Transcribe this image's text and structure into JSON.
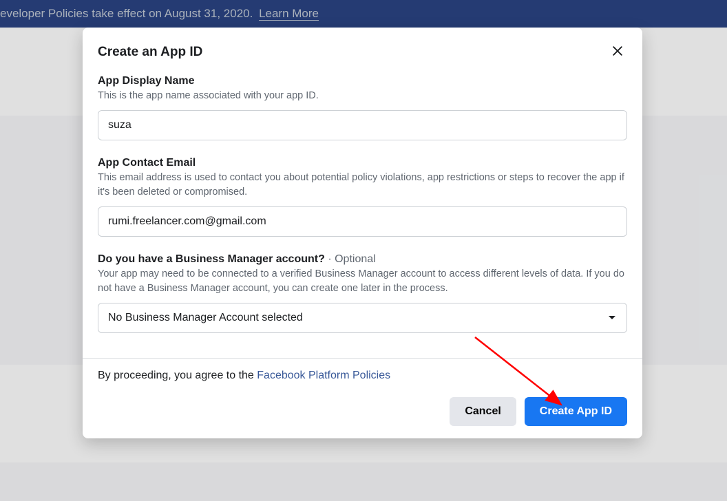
{
  "banner": {
    "text_prefix": "eveloper Policies take effect on August 31, 2020. ",
    "link": "Learn More"
  },
  "modal": {
    "title": "Create an App ID",
    "fields": {
      "display_name": {
        "label": "App Display Name",
        "help": "This is the app name associated with your app ID.",
        "value": "suza"
      },
      "contact_email": {
        "label": "App Contact Email",
        "help": "This email address is used to contact you about potential policy violations, app restrictions or steps to recover the app if it's been deleted or compromised.",
        "value": "rumi.freelancer.com@gmail.com"
      },
      "business_manager": {
        "label": "Do you have a Business Manager account?",
        "optional_tag": " · Optional",
        "help": "Your app may need to be connected to a verified Business Manager account to access different levels of data. If you do not have a Business Manager account, you can create one later in the process.",
        "selected": "No Business Manager Account selected"
      }
    },
    "footer": {
      "agree_prefix": "By proceeding, you agree to the ",
      "agree_link": "Facebook Platform Policies",
      "cancel": "Cancel",
      "create": "Create App ID"
    }
  }
}
